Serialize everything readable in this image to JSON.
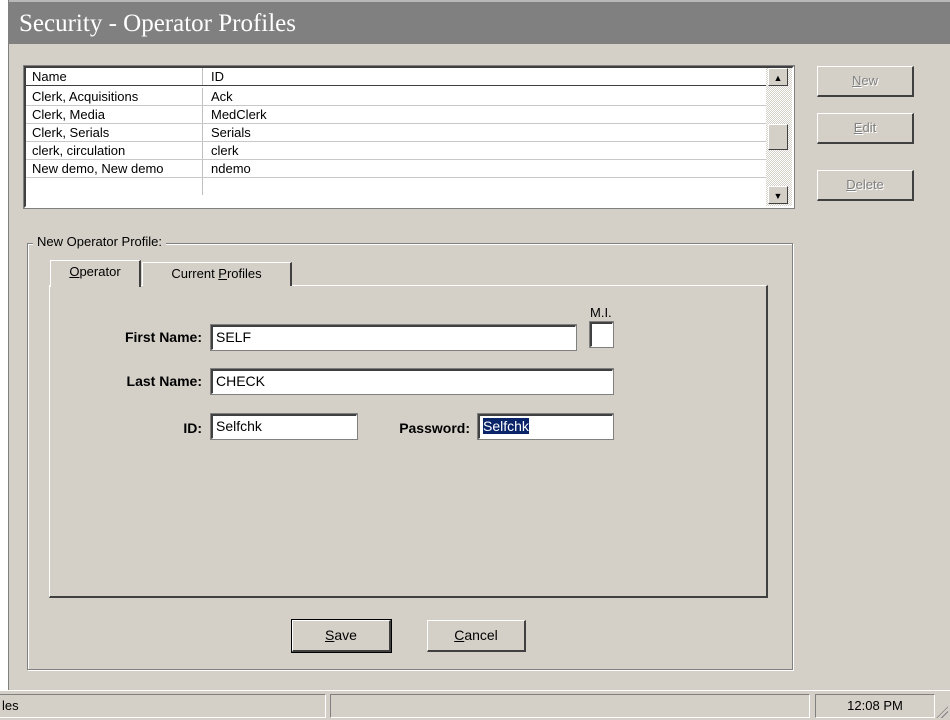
{
  "window": {
    "title": "Security - Operator Profiles"
  },
  "operator_list": {
    "columns": [
      "Name",
      "ID"
    ],
    "rows": [
      [
        "Clerk, Acquisitions",
        "Ack"
      ],
      [
        "Clerk, Media",
        "MedClerk"
      ],
      [
        "Clerk, Serials",
        "Serials"
      ],
      [
        "clerk, circulation",
        "clerk"
      ],
      [
        "New demo, New demo",
        "ndemo"
      ]
    ]
  },
  "side_buttons": {
    "new": {
      "mnemonic": "N",
      "rest": "ew"
    },
    "edit": {
      "mnemonic": "E",
      "rest": "dit"
    },
    "delete": {
      "mnemonic": "D",
      "rest": "elete"
    }
  },
  "group": {
    "legend": "New  Operator Profile:"
  },
  "tabs": {
    "operator": {
      "mnemonic": "O",
      "rest": "perator"
    },
    "current_profiles": {
      "pre": "Current ",
      "mnemonic": "P",
      "rest": "rofiles"
    }
  },
  "form": {
    "first_name_label": "First Name:",
    "first_name_value": "SELF",
    "mi_label": "M.I.",
    "mi_value": "",
    "last_name_label": "Last Name:",
    "last_name_value": "CHECK",
    "id_label": "ID:",
    "id_value": "Selfchk",
    "password_label": "Password:",
    "password_value": "Selfchk"
  },
  "actions": {
    "save": {
      "mnemonic": "S",
      "rest": "ave"
    },
    "cancel": {
      "mnemonic": "C",
      "rest": "ancel"
    }
  },
  "status_bar": {
    "left_text": "les",
    "middle_text": "",
    "time": "12:08 PM"
  },
  "colors": {
    "face": "#d4d0c8",
    "title_bar": "#808080",
    "selection": "#0a246a"
  }
}
